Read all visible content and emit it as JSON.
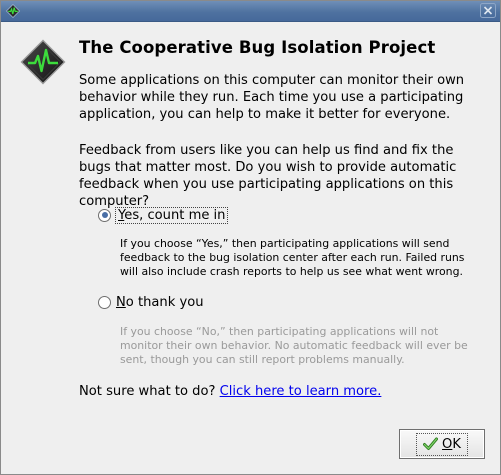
{
  "window": {
    "close_glyph": "×"
  },
  "dialog": {
    "heading": "The Cooperative Bug Isolation Project",
    "para1": "Some applications on this computer can monitor their own behavior while they run. Each time you use a participating application, you can help to make it better for everyone.",
    "para2": "Feedback from users like you can help us find and fix the bugs that matter most. Do you wish to provide automatic feedback when you use participating applications on this computer?",
    "options": [
      {
        "mnemonic": "Y",
        "label_rest": "es, count me in",
        "selected": true,
        "description": "If you choose “Yes,” then participating applications will send feedback to the bug isolation center after each run. Failed runs will also include crash reports to help us see what went wrong."
      },
      {
        "mnemonic": "N",
        "label_rest": "o thank you",
        "selected": false,
        "description": "If you choose “No,” then participating applications will not monitor their own behavior. No automatic feedback will ever be sent, though you can still report problems manually."
      }
    ],
    "help_prefix": "Not sure what to do?",
    "help_link": "Click here to learn more.",
    "ok_mnemonic": "O",
    "ok_rest": "K"
  },
  "icons": {
    "title_icon": "heartbeat-diamond-icon",
    "app_icon": "heartbeat-diamond-icon",
    "ok_icon": "checkmark-icon"
  },
  "colors": {
    "titlebar": "#4f72a0",
    "link": "#0000ee",
    "heartbeat": "#3cdc3c",
    "disabled_text": "#9a9a9a"
  }
}
